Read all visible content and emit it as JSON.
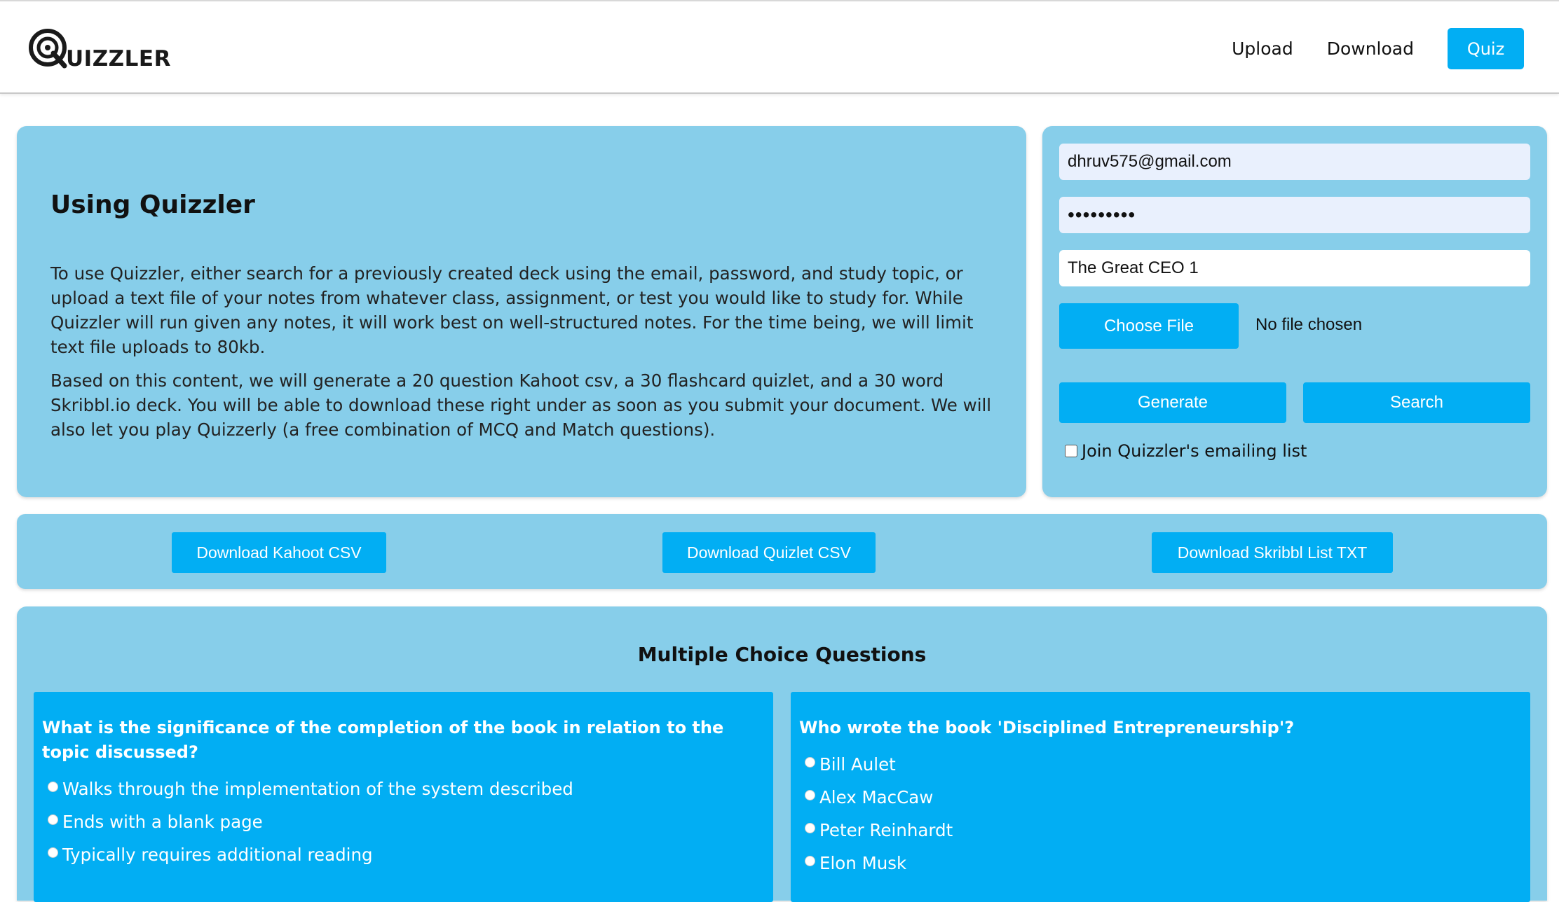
{
  "brand": {
    "name": "UIZZLER"
  },
  "nav": {
    "upload": "Upload",
    "download": "Download",
    "quiz": "Quiz"
  },
  "info": {
    "title": "Using Quizzler",
    "p1": "To use Quizzler, either search for a previously created deck using the email, password, and study topic, or upload a text file of your notes from whatever class, assignment, or test you would like to study for. While Quizzler will run given any notes, it will work best on well-structured notes. For the time being, we will limit text file uploads to 80kb.",
    "p2": "Based on this content, we will generate a 20 question Kahoot csv, a 30 flashcard quizlet, and a 30 word Skribbl.io deck. You will be able to download these right under as soon as you submit your document. We will also let you play Quizzerly (a free combination of MCQ and Match questions)."
  },
  "form": {
    "email": "dhruv575@gmail.com",
    "password": "•••••••••",
    "topic": "The Great CEO 1",
    "choose_file": "Choose File",
    "no_file": "No file chosen",
    "generate": "Generate",
    "search": "Search",
    "mailing_list": "Join Quizzler's emailing list"
  },
  "downloads": {
    "kahoot": "Download Kahoot CSV",
    "quizlet": "Download Quizlet CSV",
    "skribbl": "Download Skribbl List TXT"
  },
  "mcq": {
    "title": "Multiple Choice Questions",
    "questions": [
      {
        "text": "What is the significance of the completion of the book in relation to the topic discussed?",
        "options": [
          "Walks through the implementation of the system described",
          "Ends with a blank page",
          "Typically requires additional reading"
        ]
      },
      {
        "text": "Who wrote the book 'Disciplined Entrepreneurship'?",
        "options": [
          "Bill Aulet",
          "Alex MacCaw",
          "Peter Reinhardt",
          "Elon Musk"
        ]
      }
    ]
  },
  "colors": {
    "accent": "#02aef3",
    "panel": "#87ceea"
  }
}
